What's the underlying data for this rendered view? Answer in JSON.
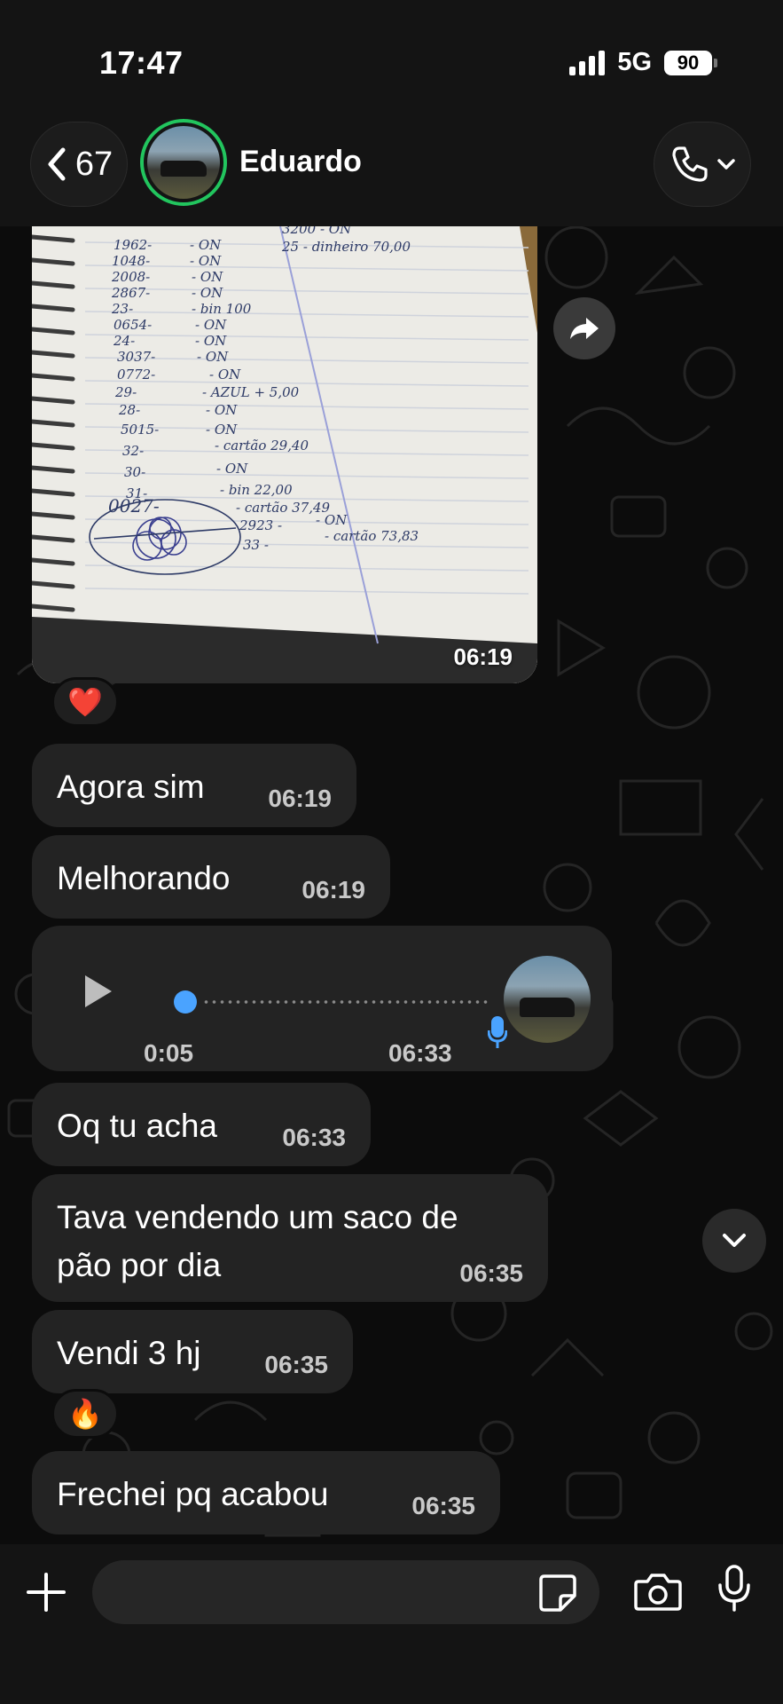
{
  "status_bar": {
    "time": "17:47",
    "network": "5G",
    "battery": "90"
  },
  "header": {
    "back_count": "67",
    "contact_name": "Eduardo",
    "icons": [
      "chevron-left-icon",
      "phone-icon",
      "chevron-down-icon"
    ]
  },
  "messages": {
    "image": {
      "time": "06:19",
      "reaction": "❤️"
    },
    "m1": {
      "text": "Agora sim",
      "time": "06:19"
    },
    "m2": {
      "text": "Melhorando",
      "time": "06:19"
    },
    "voice": {
      "duration": "0:05",
      "time": "06:33"
    },
    "m3": {
      "text": "Oq tu acha",
      "time": "06:33"
    },
    "m4": {
      "text_line1": "Tava vendendo um saco de",
      "text_line2": "pão por dia",
      "time": "06:35"
    },
    "m5": {
      "text": "Vendi 3 hj",
      "time": "06:35",
      "reaction": "🔥"
    },
    "m6": {
      "text": "Frechei pq acabou",
      "time": "06:35"
    }
  },
  "notebook": {
    "lines_left": [
      "1962-",
      "1048-",
      "2008-",
      "2867-",
      "23-",
      "0654-",
      "24-",
      "3037-",
      "0772-",
      "29-",
      "28-",
      "5015-",
      "32-",
      "30-",
      "31-",
      "0027-"
    ],
    "lines_mid": [
      "- ON",
      "- ON",
      "- ON",
      "- ON",
      "- bin 100",
      "- ON",
      "- ON",
      "- ON",
      "- ON",
      "- AZUL + 5,00",
      "- ON",
      "- ON",
      "- cartão 29,40",
      "- ON",
      "- bin 22,00",
      "- cartão 37,49"
    ],
    "extra": [
      "2923 -",
      "- ON",
      "33 -",
      "- cartão 73,83"
    ],
    "right_top": [
      "3200 - ON",
      "25 - dinheiro 70,00"
    ]
  },
  "composer": {
    "placeholder": ""
  },
  "colors": {
    "accent": "#22c55e",
    "voice_dot": "#4aa3ff",
    "bubble": "#232323"
  }
}
